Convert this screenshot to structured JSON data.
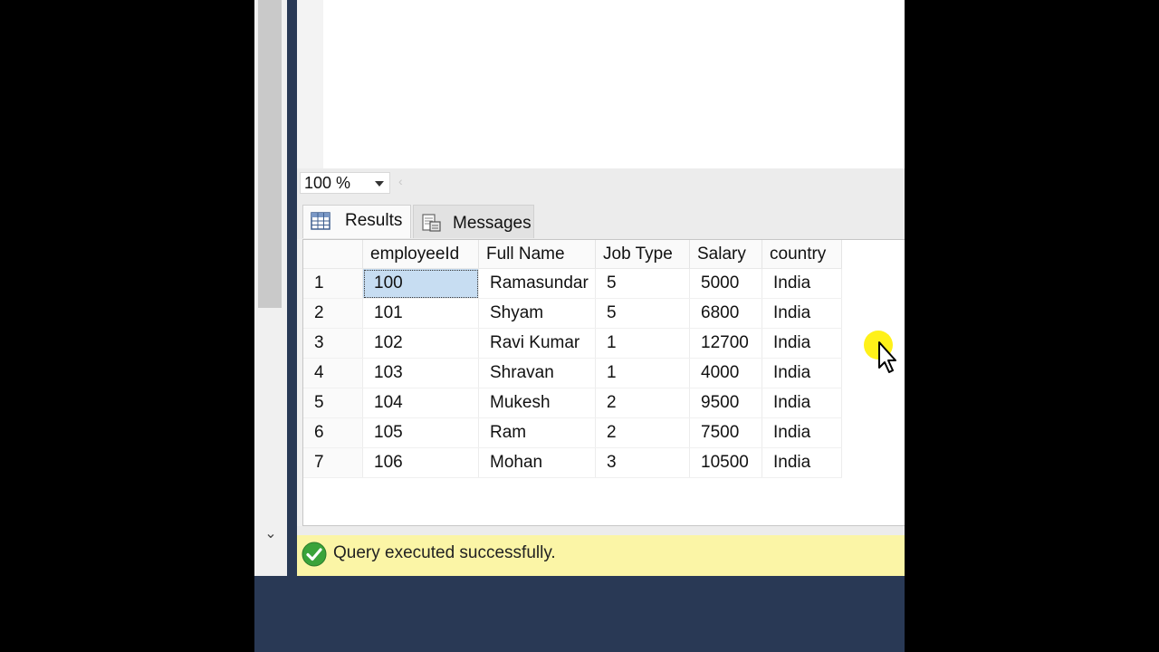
{
  "zoom": {
    "value": "100 %"
  },
  "tabs": [
    {
      "label": "Results",
      "icon": "grid-icon",
      "active": true
    },
    {
      "label": "Messages",
      "icon": "messages-icon",
      "active": false
    }
  ],
  "grid": {
    "columns": [
      "employeeId",
      "Full Name",
      "Job Type",
      "Salary",
      "country"
    ],
    "rows": [
      {
        "num": "1",
        "cells": [
          "100",
          "Ramasundar",
          "5",
          "5000",
          "India"
        ]
      },
      {
        "num": "2",
        "cells": [
          "101",
          "Shyam",
          "5",
          "6800",
          "India"
        ]
      },
      {
        "num": "3",
        "cells": [
          "102",
          "Ravi Kumar",
          "1",
          "12700",
          "India"
        ]
      },
      {
        "num": "4",
        "cells": [
          "103",
          "Shravan",
          "1",
          "4000",
          "India"
        ]
      },
      {
        "num": "5",
        "cells": [
          "104",
          "Mukesh",
          "2",
          "9500",
          "India"
        ]
      },
      {
        "num": "6",
        "cells": [
          "105",
          "Ram",
          "2",
          "7500",
          "India"
        ]
      },
      {
        "num": "7",
        "cells": [
          "106",
          "Mohan",
          "3",
          "10500",
          "India"
        ]
      }
    ]
  },
  "status": {
    "text": "Query executed successfully.",
    "icon": "success-check-icon",
    "color": "#fbf5a6"
  },
  "colors": {
    "panel_dark": "#293955",
    "selected_cell": "#c7ddf2",
    "success": "#3aa33a"
  }
}
